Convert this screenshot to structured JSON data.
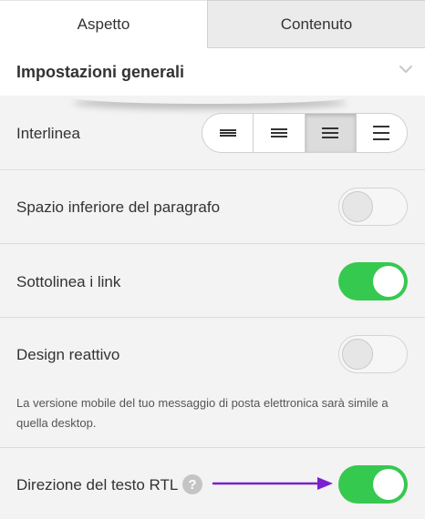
{
  "tabs": [
    {
      "label": "Aspetto",
      "active": true
    },
    {
      "label": "Contenuto",
      "active": false
    }
  ],
  "section": {
    "title": "Impostazioni generali",
    "icon": "chevron-down-icon"
  },
  "line_height": {
    "label": "Interlinea",
    "options": [
      "line-height-tight-icon",
      "line-height-normal-icon",
      "line-height-medium-icon",
      "line-height-loose-icon"
    ],
    "selected_index": 2
  },
  "paragraph_spacing": {
    "label": "Spazio inferiore del paragrafo",
    "enabled": false
  },
  "underline_links": {
    "label": "Sottolinea i link",
    "enabled": true
  },
  "responsive_design": {
    "label": "Design reattivo",
    "enabled": false,
    "description": "La versione mobile del tuo messaggio di posta elettronica sarà simile a quella desktop."
  },
  "rtl_direction": {
    "label": "Direzione del testo RTL",
    "enabled": true,
    "help": "?"
  },
  "colors": {
    "toggle_on": "#35c94f",
    "arrow": "#7d1fd1",
    "tab_active_bg": "#ffffff",
    "tab_inactive_bg": "#ebebeb"
  }
}
